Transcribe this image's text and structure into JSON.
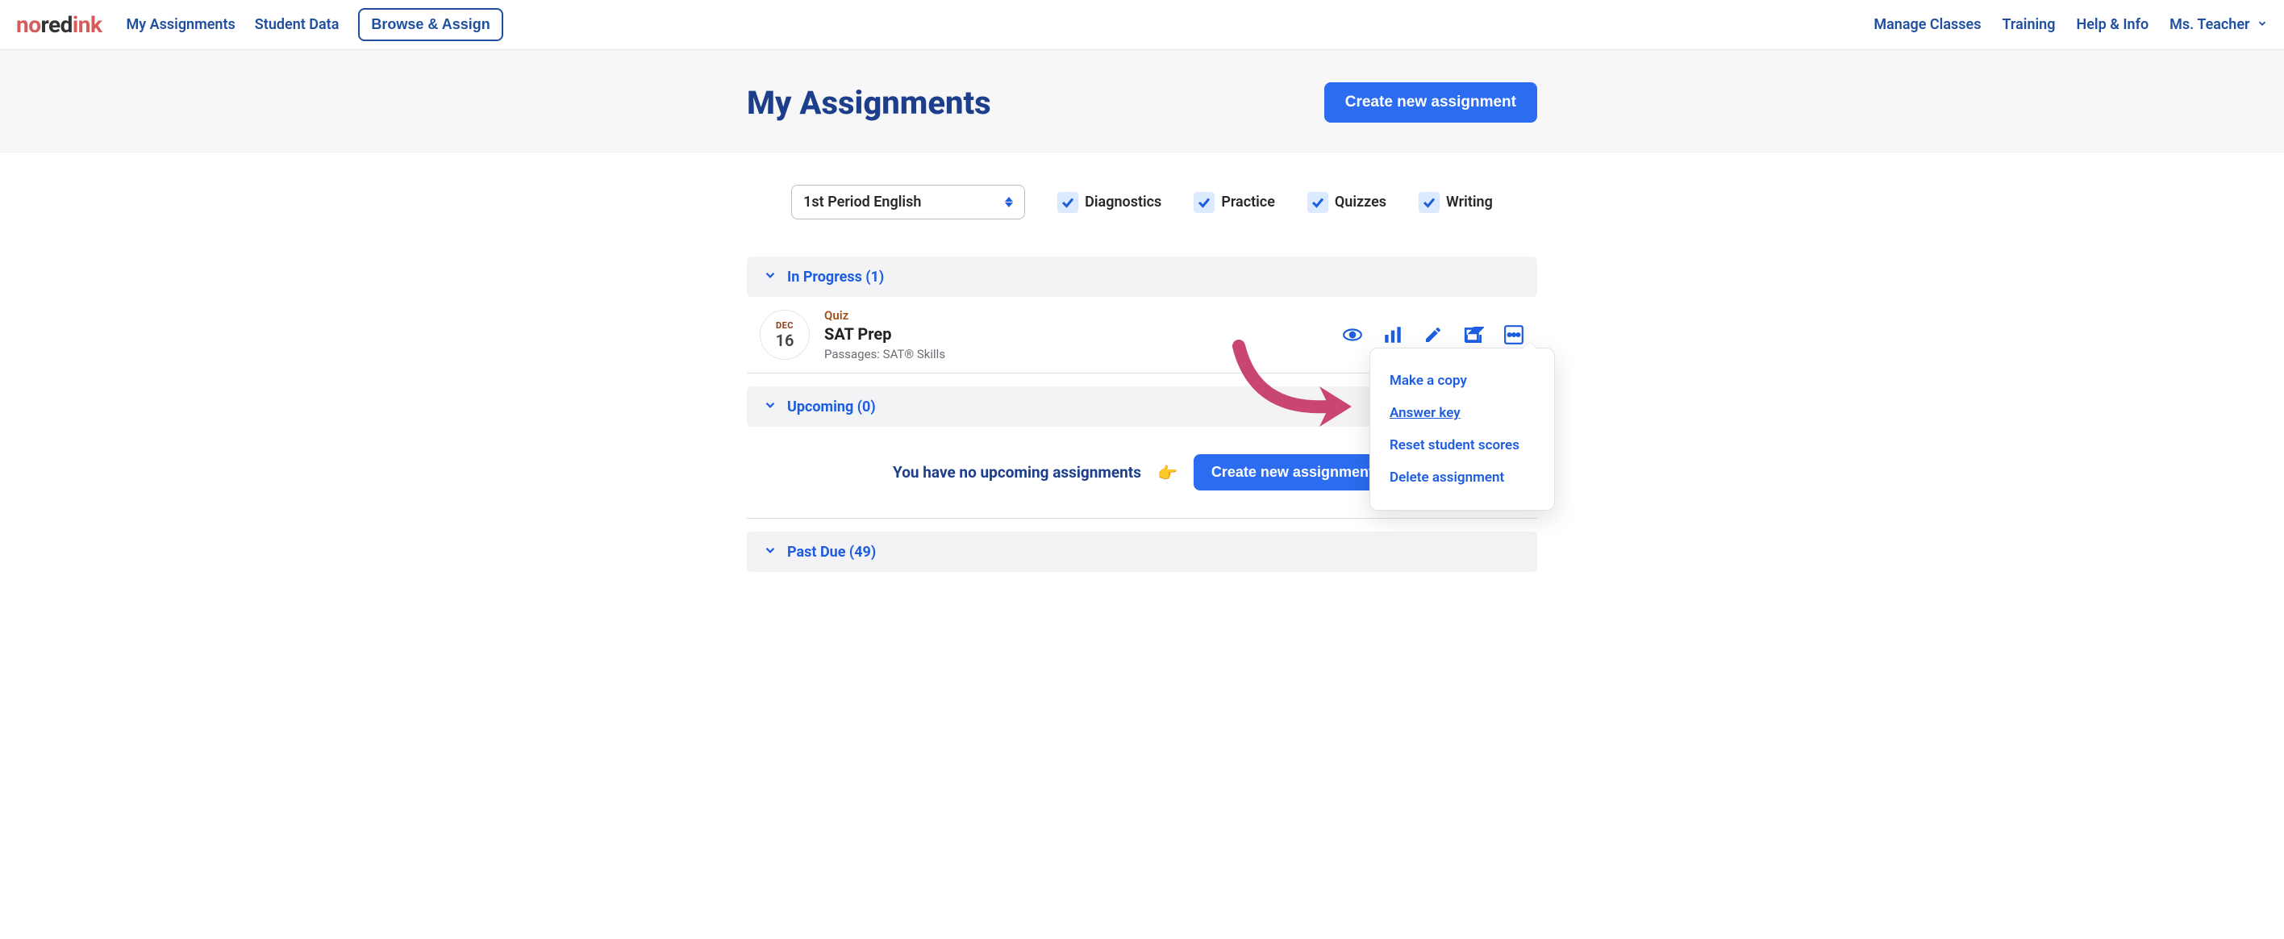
{
  "logo": {
    "no": "no",
    "red": "red",
    "ink": "ink"
  },
  "nav": {
    "left": [
      "My Assignments",
      "Student Data"
    ],
    "browse_assign": "Browse & Assign",
    "right": [
      "Manage Classes",
      "Training",
      "Help & Info"
    ],
    "user": "Ms. Teacher"
  },
  "header": {
    "title": "My Assignments",
    "cta": "Create new assignment"
  },
  "filters": {
    "class_selected": "1st Period English",
    "checks": [
      "Diagnostics",
      "Practice",
      "Quizzes",
      "Writing"
    ]
  },
  "sections": {
    "in_progress": {
      "label": "In Progress (1)"
    },
    "upcoming": {
      "label": "Upcoming (0)",
      "empty": "You have no upcoming assignments",
      "cta": "Create new assignment"
    },
    "past_due": {
      "label": "Past Due (49)"
    }
  },
  "assignment": {
    "month": "DEC",
    "day": "16",
    "type": "Quiz",
    "title": "SAT Prep",
    "sub": "Passages: SAT® Skills"
  },
  "popover": {
    "items": [
      "Make a copy",
      "Answer key",
      "Reset student scores",
      "Delete assignment"
    ]
  }
}
